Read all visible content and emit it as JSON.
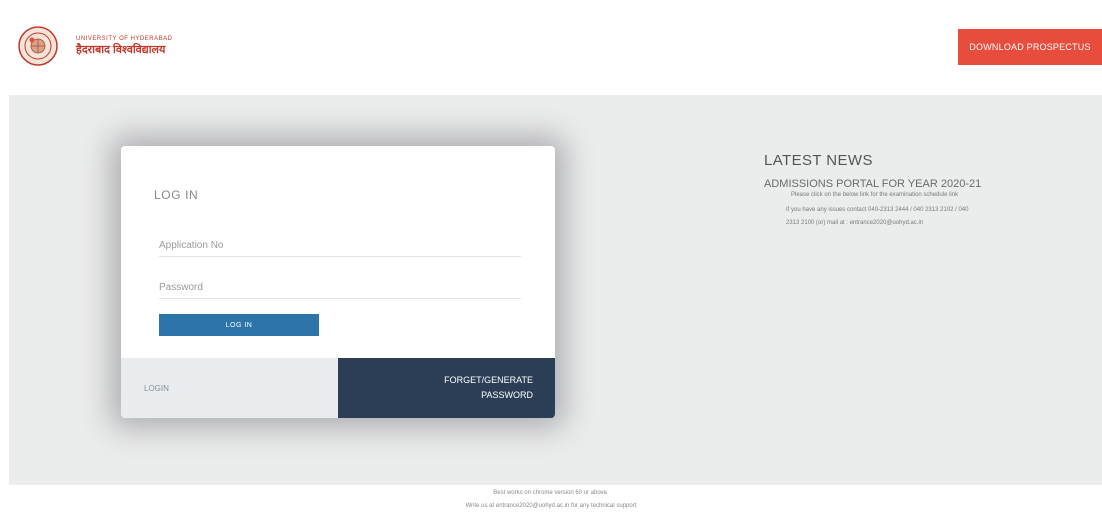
{
  "header": {
    "logo_en": "UNIVERSITY OF HYDERABAD",
    "logo_hi": "हैदराबाद विश्वविद्यालय",
    "download_label": "DOWNLOAD PROSPECTUS",
    "emblem_icon": "university-emblem-icon"
  },
  "login": {
    "title": "LOG IN",
    "application_placeholder": "Application No",
    "password_placeholder": "Password",
    "login_button": "LOG IN",
    "footer_login": "LOGIN",
    "footer_forget_line1": "FORGET/GENERATE",
    "footer_forget_line2": "PASSWORD"
  },
  "news": {
    "heading": "LATEST NEWS",
    "subheading": "ADMISSIONS PORTAL FOR YEAR 2020-21",
    "item1": "Please click on the below link for the examination schedule link",
    "item2": "If you have any issues contact 040-2313 2444 / 040 2313 2102 / 040",
    "item3": "2313 2100 (or) mail at : entrance2020@uohyd.ac.in"
  },
  "footer": {
    "note1": "Best works on chrome version 60 or above.",
    "note2": "Write us at entrance2020@uohyd.ac.in for any technical support"
  },
  "colors": {
    "accent": "#e74c3c",
    "login_button": "#2d75a8",
    "dark_panel": "#2c3e55",
    "background": "#ebecec"
  }
}
